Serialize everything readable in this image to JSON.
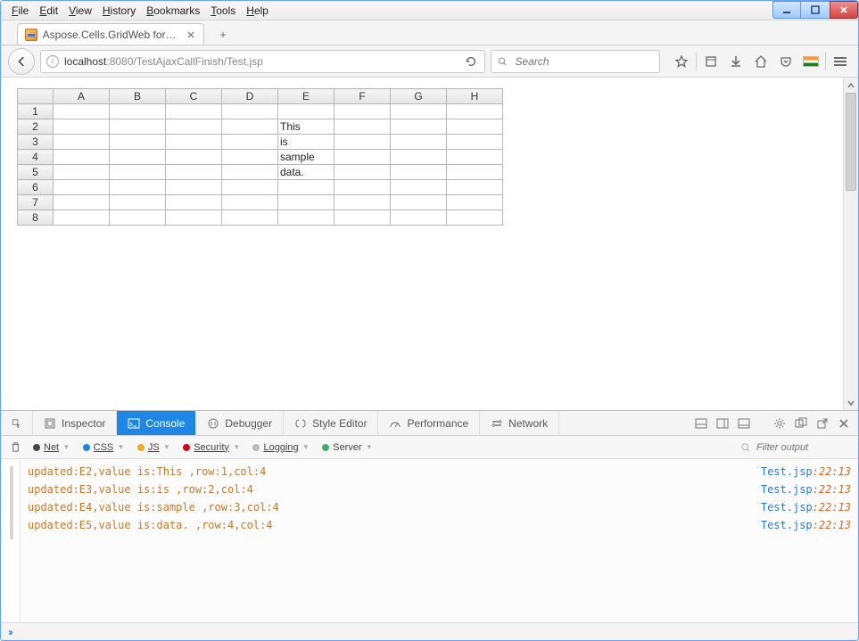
{
  "browser": {
    "menus": [
      "File",
      "Edit",
      "View",
      "History",
      "Bookmarks",
      "Tools",
      "Help"
    ],
    "tab_title": "Aspose.Cells.GridWeb for J...",
    "newtab_plus": "+",
    "url_host": "localhost",
    "url_port": ":8080",
    "url_path": "/TestAjaxCallFinish/Test.jsp",
    "search_placeholder": "Search"
  },
  "grid": {
    "columns": [
      "A",
      "B",
      "C",
      "D",
      "E",
      "F",
      "G",
      "H"
    ],
    "rows": [
      "1",
      "2",
      "3",
      "4",
      "5",
      "6",
      "7",
      "8"
    ],
    "cells": {
      "E2": "This",
      "E3": "is",
      "E4": "sample",
      "E5": "data."
    }
  },
  "devtools": {
    "tabs": {
      "inspector": "Inspector",
      "console": "Console",
      "debugger": "Debugger",
      "style": "Style Editor",
      "performance": "Performance",
      "network": "Network"
    },
    "filters": {
      "net": "Net",
      "css": "CSS",
      "js": "JS",
      "security": "Security",
      "logging": "Logging",
      "server": "Server"
    },
    "filter_placeholder": "Filter output",
    "logs": [
      {
        "msg": "updated:E2,value is:This ,row:1,col:4",
        "src": "Test.jsp",
        "pos": ":22:13"
      },
      {
        "msg": "updated:E3,value is:is ,row:2,col:4",
        "src": "Test.jsp",
        "pos": ":22:13"
      },
      {
        "msg": "updated:E4,value is:sample ,row:3,col:4",
        "src": "Test.jsp",
        "pos": ":22:13"
      },
      {
        "msg": "updated:E5,value is:data. ,row:4,col:4",
        "src": "Test.jsp",
        "pos": ":22:13"
      }
    ]
  }
}
